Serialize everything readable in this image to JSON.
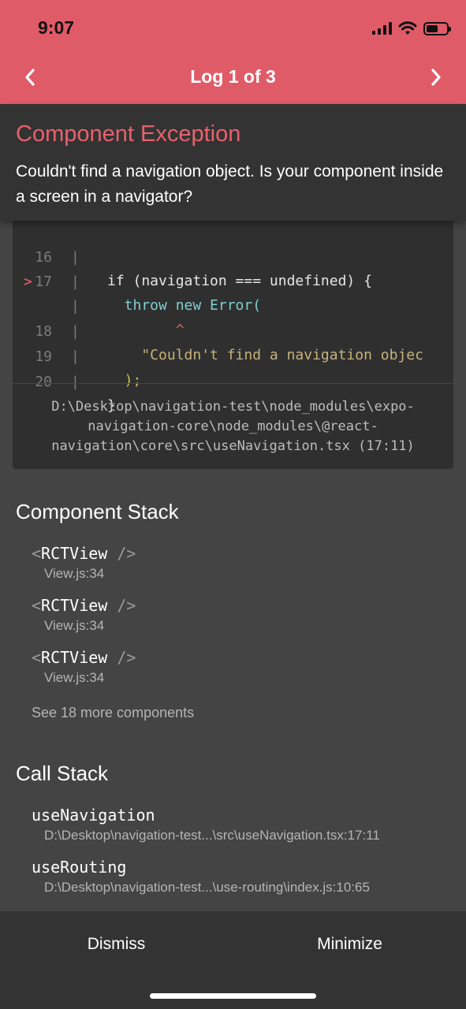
{
  "status_bar": {
    "time": "9:07"
  },
  "nav": {
    "title": "Log 1 of 3",
    "prev_icon": "chevron-left-icon",
    "next_icon": "chevron-right-icon"
  },
  "exception": {
    "title": "Component Exception",
    "message": "Couldn't find a navigation object. Is your component inside a screen in a navigator?"
  },
  "code_frame": {
    "lines": [
      {
        "marker": "",
        "num": "16",
        "bar": "|",
        "code": "if (navigation === undefined) {"
      },
      {
        "marker": ">",
        "num": "17",
        "bar": "|",
        "code": "  throw new Error("
      },
      {
        "marker": "",
        "num": "",
        "bar": "|",
        "code": "        ^"
      },
      {
        "marker": "",
        "num": "18",
        "bar": "|",
        "code": "    \"Couldn't find a navigation objec"
      },
      {
        "marker": "",
        "num": "19",
        "bar": "|",
        "code": "  );"
      },
      {
        "marker": "",
        "num": "20",
        "bar": "|",
        "code": "}"
      }
    ],
    "file_path": "D:\\Desktop\\navigation-test\\node_modules\\expo-navigation-core\\node_modules\\@react-navigation\\core\\src\\useNavigation.tsx (17:11)"
  },
  "component_stack": {
    "title": "Component Stack",
    "items": [
      {
        "open": "<",
        "name": "RCTView",
        "close": " />",
        "location": "View.js:34"
      },
      {
        "open": "<",
        "name": "RCTView",
        "close": " />",
        "location": "View.js:34"
      },
      {
        "open": "<",
        "name": "RCTView",
        "close": " />",
        "location": "View.js:34"
      }
    ],
    "see_more": "See 18 more components"
  },
  "call_stack": {
    "title": "Call Stack",
    "items": [
      {
        "name": "useNavigation",
        "location": "D:\\Desktop\\navigation-test...\\src\\useNavigation.tsx:17:11"
      },
      {
        "name": "useRouting",
        "location": "D:\\Desktop\\navigation-test...\\use-routing\\index.js:10:65"
      }
    ]
  },
  "footer": {
    "dismiss_label": "Dismiss",
    "minimize_label": "Minimize"
  },
  "battery_level": 0.6,
  "colors": {
    "accent": "#e05b68",
    "title_red": "#e8616e",
    "panel": "#333333",
    "background": "#444444"
  }
}
